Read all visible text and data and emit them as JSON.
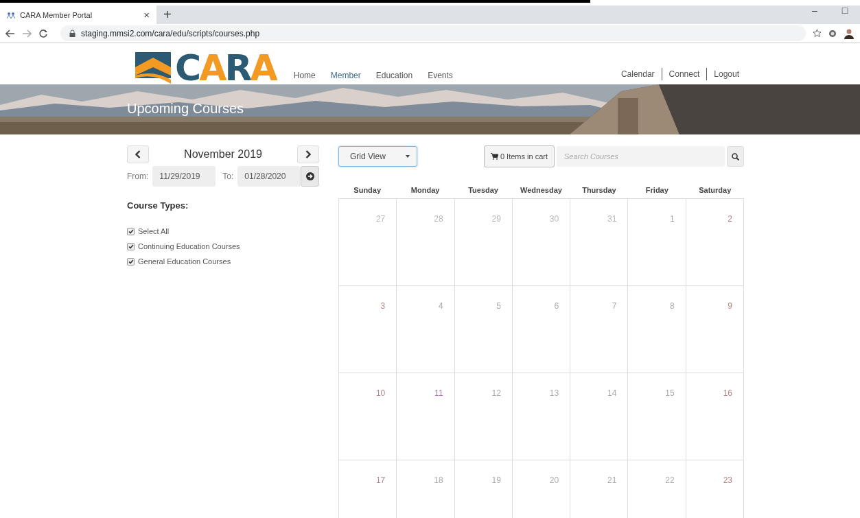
{
  "browser": {
    "tab": {
      "title": "CARA Member Portal",
      "close": "×",
      "selected": true
    },
    "new_tab": "+",
    "window_controls": [
      "–",
      "□"
    ],
    "url": "staging.mmsi2.com/cara/edu/scripts/courses.php"
  },
  "site": {
    "logo": [
      {
        "char": "C",
        "color": "#2c5a73"
      },
      {
        "char": "A",
        "color": "#f29a24"
      },
      {
        "char": "R",
        "color": "#2c5a73"
      },
      {
        "char": "A",
        "color": "#f29a24"
      }
    ],
    "nav": [
      {
        "label": "Home",
        "selected": false
      },
      {
        "label": "Member",
        "selected": true
      },
      {
        "label": "Education",
        "selected": false
      },
      {
        "label": "Events",
        "selected": false
      }
    ],
    "utility_links": [
      "Calendar",
      "Connect",
      "Logout"
    ],
    "banner": {
      "title": "Upcoming Courses"
    }
  },
  "filters": {
    "month": "November 2019",
    "from_label": "From:",
    "from": "11/29/2019",
    "to_label": "To:",
    "to": "01/28/2020",
    "course_types_title": "Course Types:",
    "course_types": [
      {
        "label": "Select All",
        "checked": true
      },
      {
        "label": "Continuing Education Courses",
        "checked": true
      },
      {
        "label": "General Education Courses",
        "checked": true
      }
    ]
  },
  "toolbar": {
    "view": "Grid View",
    "cart": "0 Items in cart",
    "search_placeholder": "Search Courses"
  },
  "calendar": {
    "weekdays": [
      "Sunday",
      "Monday",
      "Tuesday",
      "Wednesday",
      "Thursday",
      "Friday",
      "Saturday"
    ],
    "weeks": [
      [
        {
          "day": "27",
          "kind": "other"
        },
        {
          "day": "28",
          "kind": "other"
        },
        {
          "day": "29",
          "kind": "other"
        },
        {
          "day": "30",
          "kind": "other"
        },
        {
          "day": "31",
          "kind": "other"
        },
        {
          "day": "1",
          "kind": "weekday"
        },
        {
          "day": "2",
          "kind": "weekend"
        }
      ],
      [
        {
          "day": "3",
          "kind": "weekend"
        },
        {
          "day": "4",
          "kind": "weekday"
        },
        {
          "day": "5",
          "kind": "weekday"
        },
        {
          "day": "6",
          "kind": "weekday"
        },
        {
          "day": "7",
          "kind": "weekday"
        },
        {
          "day": "8",
          "kind": "weekday"
        },
        {
          "day": "9",
          "kind": "weekend"
        }
      ],
      [
        {
          "day": "10",
          "kind": "weekend"
        },
        {
          "day": "11",
          "kind": "holiday"
        },
        {
          "day": "12",
          "kind": "weekday"
        },
        {
          "day": "13",
          "kind": "weekday"
        },
        {
          "day": "14",
          "kind": "weekday"
        },
        {
          "day": "15",
          "kind": "weekday"
        },
        {
          "day": "16",
          "kind": "weekend"
        }
      ],
      [
        {
          "day": "17",
          "kind": "weekend"
        },
        {
          "day": "18",
          "kind": "weekday"
        },
        {
          "day": "19",
          "kind": "weekday"
        },
        {
          "day": "20",
          "kind": "weekday"
        },
        {
          "day": "21",
          "kind": "weekday"
        },
        {
          "day": "22",
          "kind": "weekday"
        },
        {
          "day": "23",
          "kind": "weekend"
        }
      ]
    ]
  }
}
